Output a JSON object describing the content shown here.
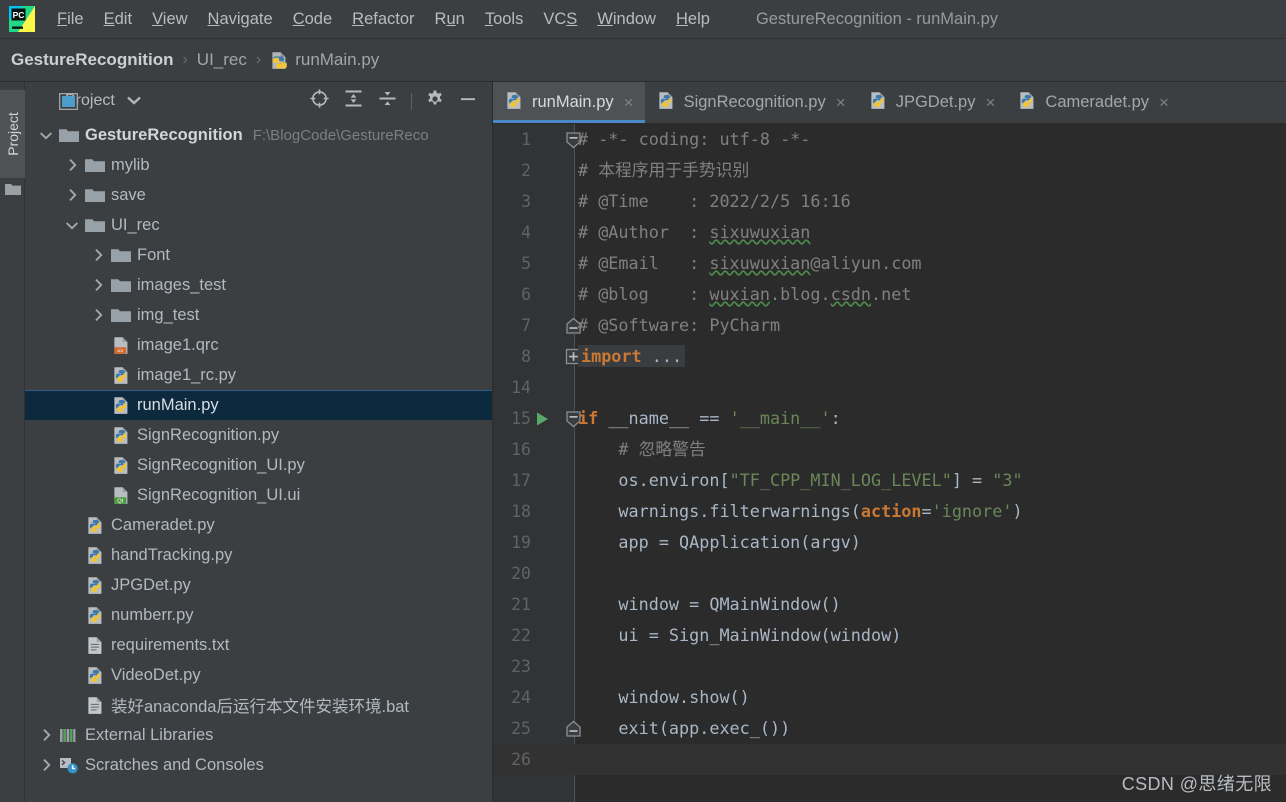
{
  "window": {
    "title": "GestureRecognition - runMain.py"
  },
  "menu": {
    "items": [
      {
        "label": "File",
        "mnemonic": "F"
      },
      {
        "label": "Edit",
        "mnemonic": "E"
      },
      {
        "label": "View",
        "mnemonic": "V"
      },
      {
        "label": "Navigate",
        "mnemonic": "N"
      },
      {
        "label": "Code",
        "mnemonic": "C"
      },
      {
        "label": "Refactor",
        "mnemonic": "R"
      },
      {
        "label": "Run",
        "mnemonic": "u"
      },
      {
        "label": "Tools",
        "mnemonic": "T"
      },
      {
        "label": "VCS",
        "mnemonic": "S"
      },
      {
        "label": "Window",
        "mnemonic": "W"
      },
      {
        "label": "Help",
        "mnemonic": "H"
      }
    ]
  },
  "breadcrumb": {
    "segments": [
      "GestureRecognition",
      "UI_rec",
      "runMain.py"
    ],
    "separator": "›"
  },
  "toolstrip": {
    "project_tab_label": "Project"
  },
  "project_panel": {
    "title": "Project",
    "actions": [
      {
        "name": "select-opened-file-icon",
        "tooltip": "Select Opened File"
      },
      {
        "name": "expand-all-icon",
        "tooltip": "Expand All"
      },
      {
        "name": "collapse-all-icon",
        "tooltip": "Collapse All"
      },
      {
        "name": "settings-gear-icon",
        "tooltip": "Settings"
      },
      {
        "name": "hide-icon",
        "tooltip": "Hide"
      }
    ],
    "tree": [
      {
        "label": "GestureRecognition",
        "path": "F:\\BlogCode\\GestureReco",
        "indent": 0,
        "twisty": "down",
        "icon": "folder",
        "bold": true,
        "selected": false
      },
      {
        "label": "mylib",
        "indent": 1,
        "twisty": "right",
        "icon": "folder",
        "bold": false,
        "selected": false
      },
      {
        "label": "save",
        "indent": 1,
        "twisty": "right",
        "icon": "folder",
        "bold": false,
        "selected": false
      },
      {
        "label": "UI_rec",
        "indent": 1,
        "twisty": "down",
        "icon": "folder",
        "bold": false,
        "selected": false
      },
      {
        "label": "Font",
        "indent": 2,
        "twisty": "right",
        "icon": "folder",
        "bold": false,
        "selected": false
      },
      {
        "label": "images_test",
        "indent": 2,
        "twisty": "right",
        "icon": "folder",
        "bold": false,
        "selected": false
      },
      {
        "label": "img_test",
        "indent": 2,
        "twisty": "right",
        "icon": "folder",
        "bold": false,
        "selected": false
      },
      {
        "label": "image1.qrc",
        "indent": 2,
        "twisty": "none",
        "icon": "qrc",
        "bold": false,
        "selected": false
      },
      {
        "label": "image1_rc.py",
        "indent": 2,
        "twisty": "none",
        "icon": "python",
        "bold": false,
        "selected": false
      },
      {
        "label": "runMain.py",
        "indent": 2,
        "twisty": "none",
        "icon": "python",
        "bold": false,
        "selected": true
      },
      {
        "label": "SignRecognition.py",
        "indent": 2,
        "twisty": "none",
        "icon": "python",
        "bold": false,
        "selected": false
      },
      {
        "label": "SignRecognition_UI.py",
        "indent": 2,
        "twisty": "none",
        "icon": "python",
        "bold": false,
        "selected": false
      },
      {
        "label": "SignRecognition_UI.ui",
        "indent": 2,
        "twisty": "none",
        "icon": "qtui",
        "bold": false,
        "selected": false
      },
      {
        "label": "Cameradet.py",
        "indent": 1,
        "twisty": "none",
        "icon": "python",
        "bold": false,
        "selected": false
      },
      {
        "label": "handTracking.py",
        "indent": 1,
        "twisty": "none",
        "icon": "python",
        "bold": false,
        "selected": false
      },
      {
        "label": "JPGDet.py",
        "indent": 1,
        "twisty": "none",
        "icon": "python",
        "bold": false,
        "selected": false
      },
      {
        "label": "numberr.py",
        "indent": 1,
        "twisty": "none",
        "icon": "python",
        "bold": false,
        "selected": false
      },
      {
        "label": "requirements.txt",
        "indent": 1,
        "twisty": "none",
        "icon": "text",
        "bold": false,
        "selected": false
      },
      {
        "label": "VideoDet.py",
        "indent": 1,
        "twisty": "none",
        "icon": "python",
        "bold": false,
        "selected": false
      },
      {
        "label": "装好anaconda后运行本文件安装环境.bat",
        "indent": 1,
        "twisty": "none",
        "icon": "text",
        "bold": false,
        "selected": false
      },
      {
        "label": "External Libraries",
        "indent": 0,
        "twisty": "right",
        "icon": "libs",
        "bold": false,
        "selected": false
      },
      {
        "label": "Scratches and Consoles",
        "indent": 0,
        "twisty": "right",
        "icon": "scratch",
        "bold": false,
        "selected": false
      }
    ]
  },
  "editor": {
    "tabs": [
      {
        "label": "runMain.py",
        "icon": "python",
        "active": true,
        "closable": true
      },
      {
        "label": "SignRecognition.py",
        "icon": "python",
        "active": false,
        "closable": true
      },
      {
        "label": "JPGDet.py",
        "icon": "python",
        "active": false,
        "closable": true
      },
      {
        "label": "Cameradet.py",
        "icon": "python",
        "active": false,
        "closable": true
      }
    ],
    "lines": [
      {
        "num": "1",
        "fold": "collapse-top",
        "run": false,
        "caret": false,
        "text": "# -*- coding: utf-8 -*-"
      },
      {
        "num": "2",
        "fold": "none",
        "run": false,
        "caret": false,
        "text": "# 本程序用于手势识别"
      },
      {
        "num": "3",
        "fold": "none",
        "run": false,
        "caret": false,
        "text": "# @Time    : 2022/2/5 16:16"
      },
      {
        "num": "4",
        "fold": "none",
        "run": false,
        "caret": false,
        "text": "# @Author  : sixuwuxian"
      },
      {
        "num": "5",
        "fold": "none",
        "run": false,
        "caret": false,
        "text": "# @Email   : sixuwuxian@aliyun.com"
      },
      {
        "num": "6",
        "fold": "none",
        "run": false,
        "caret": false,
        "text": "# @blog    : wuxian.blog.csdn.net"
      },
      {
        "num": "7",
        "fold": "collapse-bottom",
        "run": false,
        "caret": false,
        "text": "# @Software: PyCharm"
      },
      {
        "num": "8",
        "fold": "expand",
        "run": false,
        "caret": false,
        "text": "import ..."
      },
      {
        "num": "14",
        "fold": "none",
        "run": false,
        "caret": false,
        "text": ""
      },
      {
        "num": "15",
        "fold": "collapse-top",
        "run": true,
        "caret": false,
        "text": "if __name__ == '__main__':"
      },
      {
        "num": "16",
        "fold": "none",
        "run": false,
        "caret": false,
        "text": "    # 忽略警告"
      },
      {
        "num": "17",
        "fold": "none",
        "run": false,
        "caret": false,
        "text": "    os.environ[\"TF_CPP_MIN_LOG_LEVEL\"] = \"3\""
      },
      {
        "num": "18",
        "fold": "none",
        "run": false,
        "caret": false,
        "text": "    warnings.filterwarnings(action='ignore')"
      },
      {
        "num": "19",
        "fold": "none",
        "run": false,
        "caret": false,
        "text": "    app = QApplication(argv)"
      },
      {
        "num": "20",
        "fold": "none",
        "run": false,
        "caret": false,
        "text": ""
      },
      {
        "num": "21",
        "fold": "none",
        "run": false,
        "caret": false,
        "text": "    window = QMainWindow()"
      },
      {
        "num": "22",
        "fold": "none",
        "run": false,
        "caret": false,
        "text": "    ui = Sign_MainWindow(window)"
      },
      {
        "num": "23",
        "fold": "none",
        "run": false,
        "caret": false,
        "text": ""
      },
      {
        "num": "24",
        "fold": "none",
        "run": false,
        "caret": false,
        "text": "    window.show()"
      },
      {
        "num": "25",
        "fold": "collapse-bottom",
        "run": false,
        "caret": false,
        "text": "    exit(app.exec_())"
      },
      {
        "num": "26",
        "fold": "none",
        "run": false,
        "caret": true,
        "text": ""
      }
    ]
  },
  "watermark": {
    "text": "CSDN @思绪无限"
  },
  "colors": {
    "accent_tab": "#4a88c7",
    "selection": "#0d293e",
    "keyword": "#cc7832",
    "string": "#6a8759",
    "comment": "#808080",
    "default_text": "#a9b7c6",
    "editor_bg": "#2b2b2b",
    "panel_bg": "#3c3f41"
  }
}
